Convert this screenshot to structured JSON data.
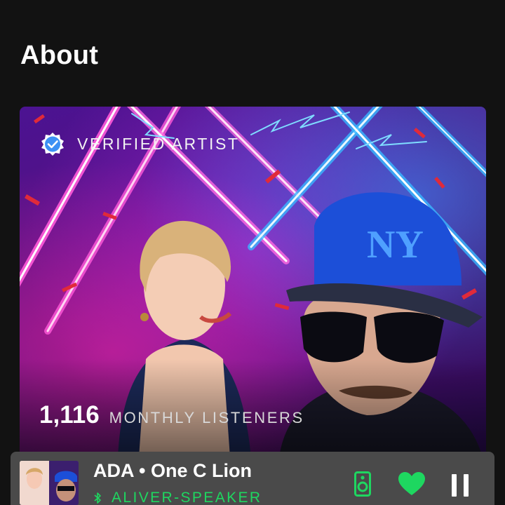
{
  "section": {
    "title": "About"
  },
  "artist_card": {
    "verified_label": "VERIFIED ARTIST",
    "monthly_listeners_count": "1,116",
    "monthly_listeners_label": "MONTHLY LISTENERS",
    "verified_icon": "verified-check-icon"
  },
  "now_playing": {
    "track_text": "ADA • One C Lion",
    "device_name": "ALIVER-SPEAKER",
    "device_icon": "bluetooth-icon",
    "connect_icon": "speaker-device-icon",
    "like_icon": "heart-filled-icon",
    "playback_icon": "pause-icon",
    "accent_color": "#1ed760"
  }
}
